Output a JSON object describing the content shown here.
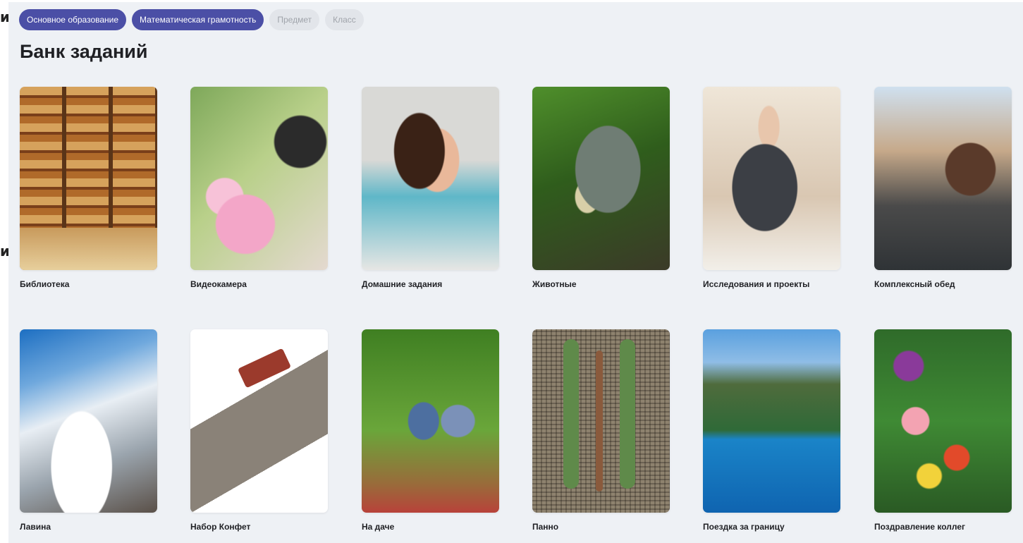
{
  "edge_glyphs": [
    "и",
    "и"
  ],
  "filters": [
    {
      "label": "Основное образование",
      "active": true
    },
    {
      "label": "Математическая грамотность",
      "active": true
    },
    {
      "label": "Предмет",
      "active": false
    },
    {
      "label": "Класс",
      "active": false
    }
  ],
  "page_title": "Банк заданий",
  "cards": [
    {
      "label": "Библиотека",
      "image": "library-photo"
    },
    {
      "label": "Видеокамера",
      "image": "camera-photo"
    },
    {
      "label": "Домашние задания",
      "image": "homework-photo"
    },
    {
      "label": "Животные",
      "image": "crocodile-photo"
    },
    {
      "label": "Исследования и проекты",
      "image": "presentation-photo"
    },
    {
      "label": "Комплексный обед",
      "image": "cafe-photo"
    },
    {
      "label": "Лавина",
      "image": "avalanche-photo"
    },
    {
      "label": "Набор Конфет",
      "image": "candy-box-photo"
    },
    {
      "label": "На даче",
      "image": "garden-photo"
    },
    {
      "label": "Панно",
      "image": "mosaic-photo"
    },
    {
      "label": "Поездка за границу",
      "image": "seaside-photo"
    },
    {
      "label": "Поздравление коллег",
      "image": "flowers-photo"
    }
  ],
  "colors": {
    "background": "#eef1f5",
    "chip_active": "#4b4fa6",
    "chip_inactive": "#e2e5ea",
    "title": "#1f2024"
  }
}
